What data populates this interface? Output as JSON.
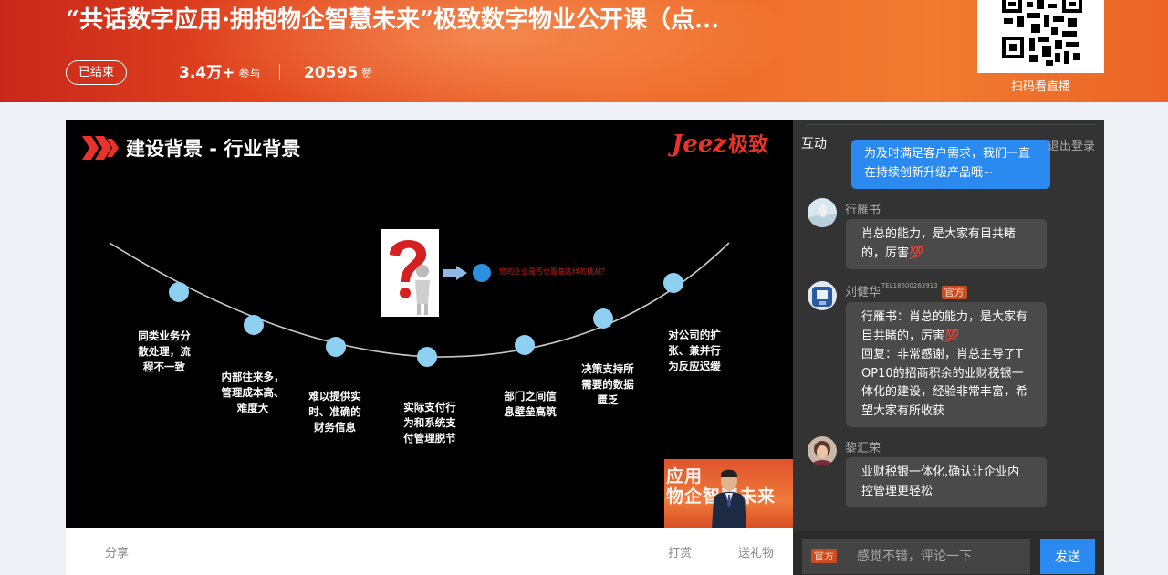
{
  "header": {
    "title": "“共话数字应用·拥抱物企智慧未来”极致数字物业公开课（点...",
    "status": "已结束",
    "viewers": {
      "value": "3.4万+",
      "unit": "参与"
    },
    "divider": "|",
    "likes": {
      "value": "20595",
      "unit": "赞"
    },
    "qr_caption": "扫码看直播"
  },
  "slide": {
    "title": "建设背景 - 行业背景",
    "brand_latin": "Jeez",
    "brand_cn": "极致",
    "question_text": "您的企业是否也面临这样的挑战？",
    "labels": [
      {
        "lines": [
          "同类业务分",
          "散处理，流",
          "程不一致"
        ]
      },
      {
        "lines": [
          "内部往来多，",
          "管理成本高、",
          "难度大"
        ]
      },
      {
        "lines": [
          "难以提供实",
          "时、准确的",
          "财务信息"
        ]
      },
      {
        "lines": [
          "实际支付行",
          "为和系统支",
          "付管理脱节"
        ]
      },
      {
        "lines": [
          "部门之间信",
          "息壁垒高筑"
        ]
      },
      {
        "lines": [
          "决策支持所",
          "需要的数据",
          "匮乏"
        ]
      },
      {
        "lines": [
          "对公司的扩",
          "张、兼并行",
          "为反应迟缓"
        ]
      }
    ],
    "pip_text": [
      "应用",
      "物企智慧未来"
    ]
  },
  "actions": {
    "share": "分享",
    "reward": "打赏",
    "gift": "送礼物"
  },
  "panel": {
    "tab": "互动",
    "logout": "退出登录",
    "messages": [
      {
        "author": "",
        "text": "为及时满足客户需求，我们一直在持续创新升级产品哦~",
        "own": true
      },
      {
        "author": "行雁书",
        "text": "肖总的能力，是大家有目共睹的，厉害💯"
      },
      {
        "author": "刘健华",
        "author_sup": "TEL18600263913",
        "badge": "官方",
        "text": "行雁书：肖总的能力，是大家有目共睹的，厉害💯\n回复：非常感谢，肖总主导了TOP10的招商积余的业财税银一体化的建设，经验非常丰富，希望大家有所收获"
      },
      {
        "author": "黎汇荣",
        "text": "业财税银一体化,确认让企业内控管理更轻松"
      }
    ],
    "input": {
      "badge": "官方",
      "placeholder": "感觉不错，评论一下",
      "send": "发送"
    }
  },
  "colors": {
    "banner_start": "#c8271a",
    "banner_end": "#f07a30",
    "accent_blue": "#2a8af0",
    "panel_bg": "#333333",
    "brand_red": "#e8322a"
  }
}
